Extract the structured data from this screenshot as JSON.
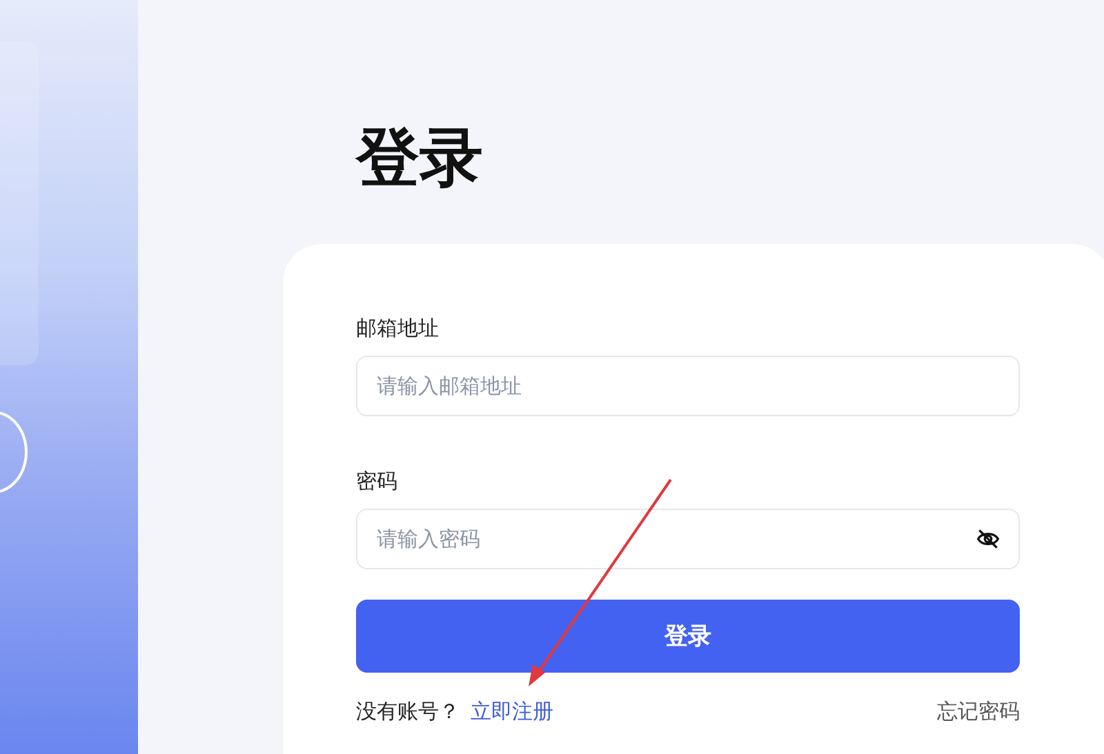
{
  "title": "登录",
  "form": {
    "email": {
      "label": "邮箱地址",
      "placeholder": "请输入邮箱地址"
    },
    "password": {
      "label": "密码",
      "placeholder": "请输入密码",
      "visible": false
    },
    "submit": "登录",
    "footer": {
      "prompt": "没有账号？",
      "register_link": "立即注册",
      "forgot_link": "忘记密码"
    }
  }
}
